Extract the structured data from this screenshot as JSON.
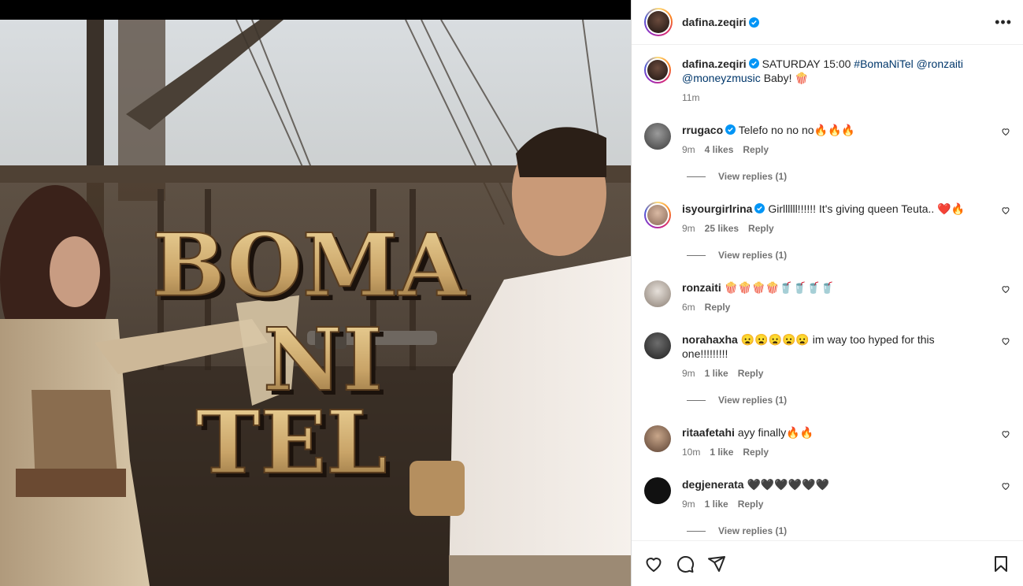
{
  "post": {
    "author": "dafina.zeqiri",
    "caption_text": "SATURDAY 15:00",
    "caption_hashtag": "#BomaNiTel",
    "caption_mention1": "@ronzaiti",
    "caption_mention2": "@moneyzmusic",
    "caption_tail": "Baby! 🍿",
    "time": "11m"
  },
  "media": {
    "title_line1": "BOMA",
    "title_line2": "NI",
    "title_line3": "TEL"
  },
  "comments": [
    {
      "user": "rrugaco",
      "verified": true,
      "text": "Telefo no no no🔥🔥🔥",
      "time": "9m",
      "likes": "4 likes",
      "reply": "Reply",
      "view_replies": "View replies (1)"
    },
    {
      "user": "isyourgirlrina",
      "verified": true,
      "text": "Girllllll!!!!!! It's giving queen Teuta.. ❤️🔥",
      "time": "9m",
      "likes": "25 likes",
      "reply": "Reply",
      "view_replies": "View replies (1)"
    },
    {
      "user": "ronzaiti",
      "verified": false,
      "text": "🍿🍿🍿🍿🥤🥤🥤🥤",
      "time": "6m",
      "likes": "",
      "reply": "Reply",
      "view_replies": ""
    },
    {
      "user": "norahaxha",
      "verified": false,
      "text": "😦😦😦😦😦 im way too hyped for this one!!!!!!!!!",
      "time": "9m",
      "likes": "1 like",
      "reply": "Reply",
      "view_replies": "View replies (1)"
    },
    {
      "user": "ritaafetahi",
      "verified": false,
      "text": "ayy finally🔥🔥",
      "time": "10m",
      "likes": "1 like",
      "reply": "Reply",
      "view_replies": ""
    },
    {
      "user": "degjenerata",
      "verified": false,
      "text": "🖤🖤🖤🖤🖤🖤",
      "time": "9m",
      "likes": "1 like",
      "reply": "Reply",
      "view_replies": "View replies (1)"
    }
  ],
  "icons": {
    "like": "heart-icon",
    "comment": "comment-icon",
    "share": "share-icon",
    "save": "bookmark-icon",
    "more": "more-options-icon",
    "verified": "verified-badge-icon"
  },
  "colors": {
    "verified": "#0095f6",
    "link": "#00376b",
    "secondary": "#737373"
  }
}
